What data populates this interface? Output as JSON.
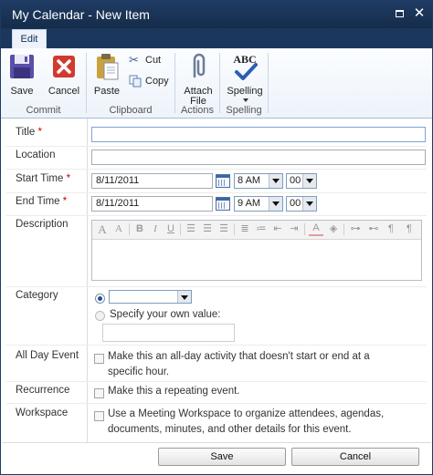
{
  "window": {
    "title": "My Calendar - New Item"
  },
  "ribbon": {
    "tab": "Edit",
    "groups": {
      "commit": {
        "label": "Commit",
        "save": "Save",
        "cancel": "Cancel"
      },
      "clipboard": {
        "label": "Clipboard",
        "paste": "Paste",
        "cut": "Cut",
        "copy": "Copy"
      },
      "actions": {
        "label": "Actions",
        "attach_line1": "Attach",
        "attach_line2": "File"
      },
      "spelling": {
        "label": "Spelling",
        "button": "Spelling",
        "icon_text": "ABC"
      }
    }
  },
  "form": {
    "title_label": "Title",
    "title_value": "",
    "location_label": "Location",
    "location_value": "",
    "start_label": "Start Time",
    "start_date": "8/11/2011",
    "start_hour": "8 AM",
    "start_min": "00",
    "end_label": "End Time",
    "end_date": "8/11/2011",
    "end_hour": "9 AM",
    "end_min": "00",
    "required_mark": "*",
    "description_label": "Description",
    "description_value": "",
    "category_label": "Category",
    "category_selected": "",
    "specify_label": "Specify your own value:",
    "specify_value": "",
    "allday_label": "All Day Event",
    "allday_text": "Make this an all-day activity that doesn't start or end at a specific hour.",
    "recurrence_label": "Recurrence",
    "recurrence_text": "Make this a repeating event.",
    "workspace_label": "Workspace",
    "workspace_text": "Use a Meeting Workspace to organize attendees, agendas, documents, minutes, and other details for this event."
  },
  "rte_toolbar": {
    "font": "A",
    "size": "A",
    "bold": "B",
    "italic": "I",
    "underline": "U",
    "font_color": "A"
  },
  "buttons": {
    "save": "Save",
    "cancel": "Cancel"
  },
  "colors": {
    "title_bar": "#1c375c",
    "required": "#cc0000",
    "accent": "#1d4e9a"
  }
}
